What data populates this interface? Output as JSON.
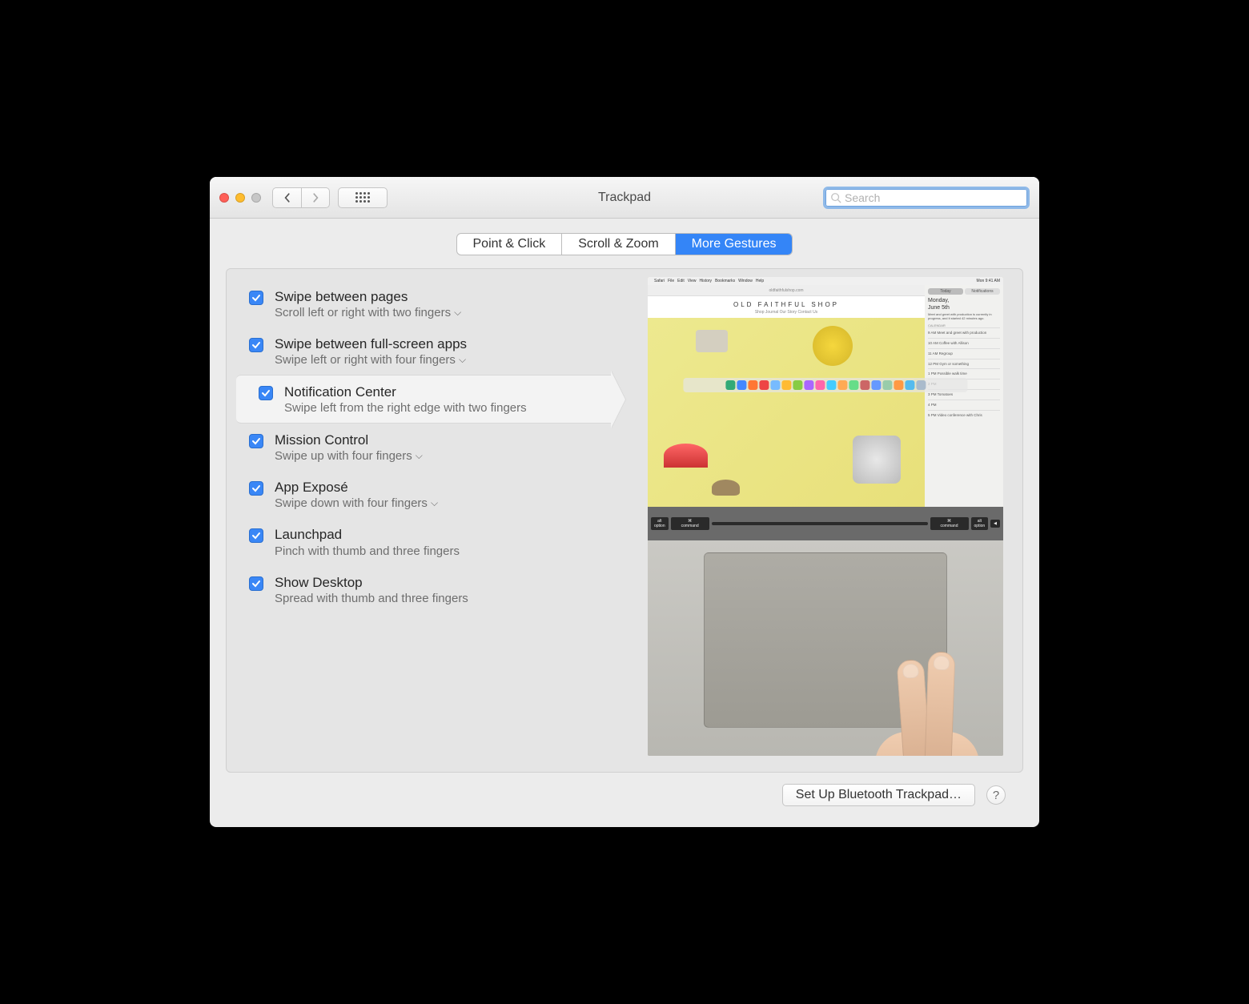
{
  "window": {
    "title": "Trackpad"
  },
  "search": {
    "placeholder": "Search",
    "value": ""
  },
  "tabs": [
    {
      "label": "Point & Click",
      "active": false
    },
    {
      "label": "Scroll & Zoom",
      "active": false
    },
    {
      "label": "More Gestures",
      "active": true
    }
  ],
  "options": [
    {
      "title": "Swipe between pages",
      "subtitle": "Scroll left or right with two fingers",
      "checked": true,
      "dropdown": true,
      "selected": false
    },
    {
      "title": "Swipe between full-screen apps",
      "subtitle": "Swipe left or right with four fingers",
      "checked": true,
      "dropdown": true,
      "selected": false
    },
    {
      "title": "Notification Center",
      "subtitle": "Swipe left from the right edge with two fingers",
      "checked": true,
      "dropdown": false,
      "selected": true
    },
    {
      "title": "Mission Control",
      "subtitle": "Swipe up with four fingers",
      "checked": true,
      "dropdown": true,
      "selected": false
    },
    {
      "title": "App Exposé",
      "subtitle": "Swipe down with four fingers",
      "checked": true,
      "dropdown": true,
      "selected": false
    },
    {
      "title": "Launchpad",
      "subtitle": "Pinch with thumb and three fingers",
      "checked": true,
      "dropdown": false,
      "selected": false
    },
    {
      "title": "Show Desktop",
      "subtitle": "Spread with thumb and three fingers",
      "checked": true,
      "dropdown": false,
      "selected": false
    }
  ],
  "preview": {
    "menubar_items": [
      "Safari",
      "File",
      "Edit",
      "View",
      "History",
      "Bookmarks",
      "Window",
      "Help"
    ],
    "menubar_right": "Mon 9:41 AM",
    "browser_url": "oldfaithfulshop.com",
    "shop_title": "OLD FAITHFUL SHOP",
    "shop_nav": "Shop   Journal   Our Story   Contact Us",
    "notification": {
      "tabs": [
        "Today",
        "Notifications"
      ],
      "day": "Monday,",
      "date": "June 5th",
      "summary": "Meet and greet with production is currently in progress, and it started 42 minutes ago.",
      "section": "CALENDAR",
      "events": [
        "9 AM  Meet and greet with production",
        "10 AM Coffee with Allison",
        "11 AM Regroup",
        "12 PM Gym or something",
        "1 PM  Possible walk time",
        "2 PM",
        "3 PM  Tomatoes",
        "4 PM",
        "5 PM  Video conference with Chris"
      ]
    },
    "keys_left": [
      "alt",
      "option",
      "⌘",
      "command"
    ],
    "keys_right": [
      "⌘",
      "command",
      "alt",
      "option"
    ]
  },
  "footer": {
    "setup_button": "Set Up Bluetooth Trackpad…",
    "help": "?"
  }
}
